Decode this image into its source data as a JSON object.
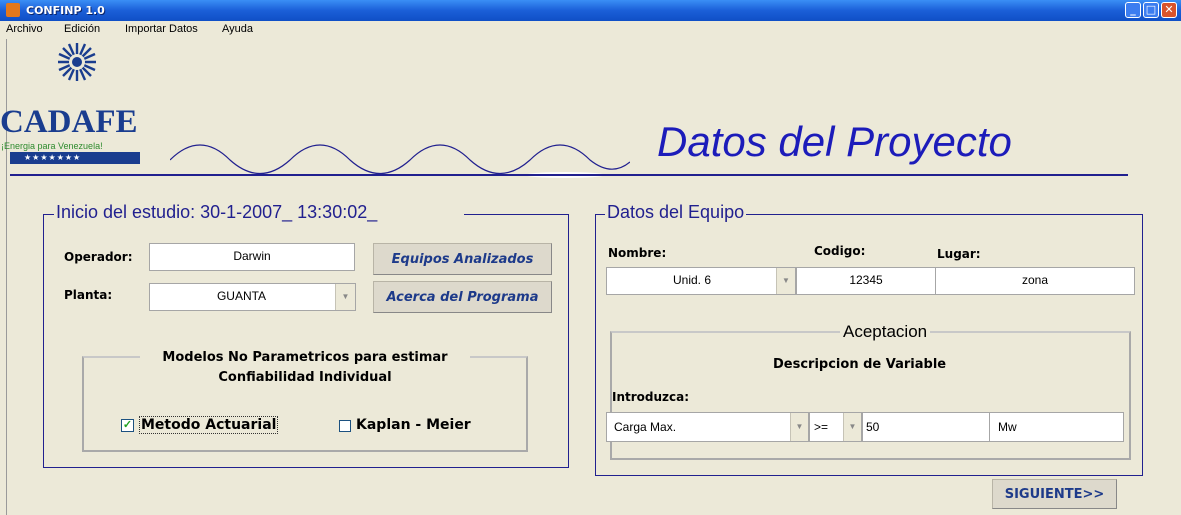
{
  "window": {
    "title": "CONFINP 1.0"
  },
  "menu": {
    "items": [
      "Archivo",
      "Edición",
      "Importar Datos",
      "Ayuda"
    ]
  },
  "logo": {
    "name": "CADAFE",
    "slogan": "¡Energia para Venezuela!",
    "stars": "★★★★★★★"
  },
  "heading": "Datos del Proyecto",
  "study": {
    "title": "Inicio del estudio:  30-1-2007_ 13:30:02_",
    "operator_label": "Operador:",
    "operator_value": "Darwin",
    "plant_label": "Planta:",
    "plant_value": "GUANTA",
    "btn_equipos": "Equipos Analizados",
    "btn_acerca": "Acerca del Programa",
    "models_title_line1": "Modelos No Parametricos para estimar",
    "models_title_line2": "Confiabilidad Individual",
    "option_actuarial": "Metodo Actuarial",
    "option_actuarial_checked": true,
    "option_kaplan": "Kaplan - Meier",
    "option_kaplan_checked": false
  },
  "equipo": {
    "title": "Datos del Equipo",
    "nombre_label": "Nombre:",
    "nombre_value": "Unid.  6",
    "codigo_label": "Codigo:",
    "codigo_value": "12345",
    "lugar_label": "Lugar:",
    "lugar_value": "zona",
    "aceptacion_title": "Aceptacion",
    "descripcion": "Descripcion de Variable",
    "introduzca_label": "Introduzca:",
    "variable_value": "Carga Max.",
    "operator_value": ">=",
    "threshold_value": "50",
    "unit_value": "Mw"
  },
  "next_button": "SIGUIENTE>>",
  "colors": {
    "accent": "#21208f",
    "titlebar": "#1b5fd8",
    "background": "#ece9d8"
  }
}
